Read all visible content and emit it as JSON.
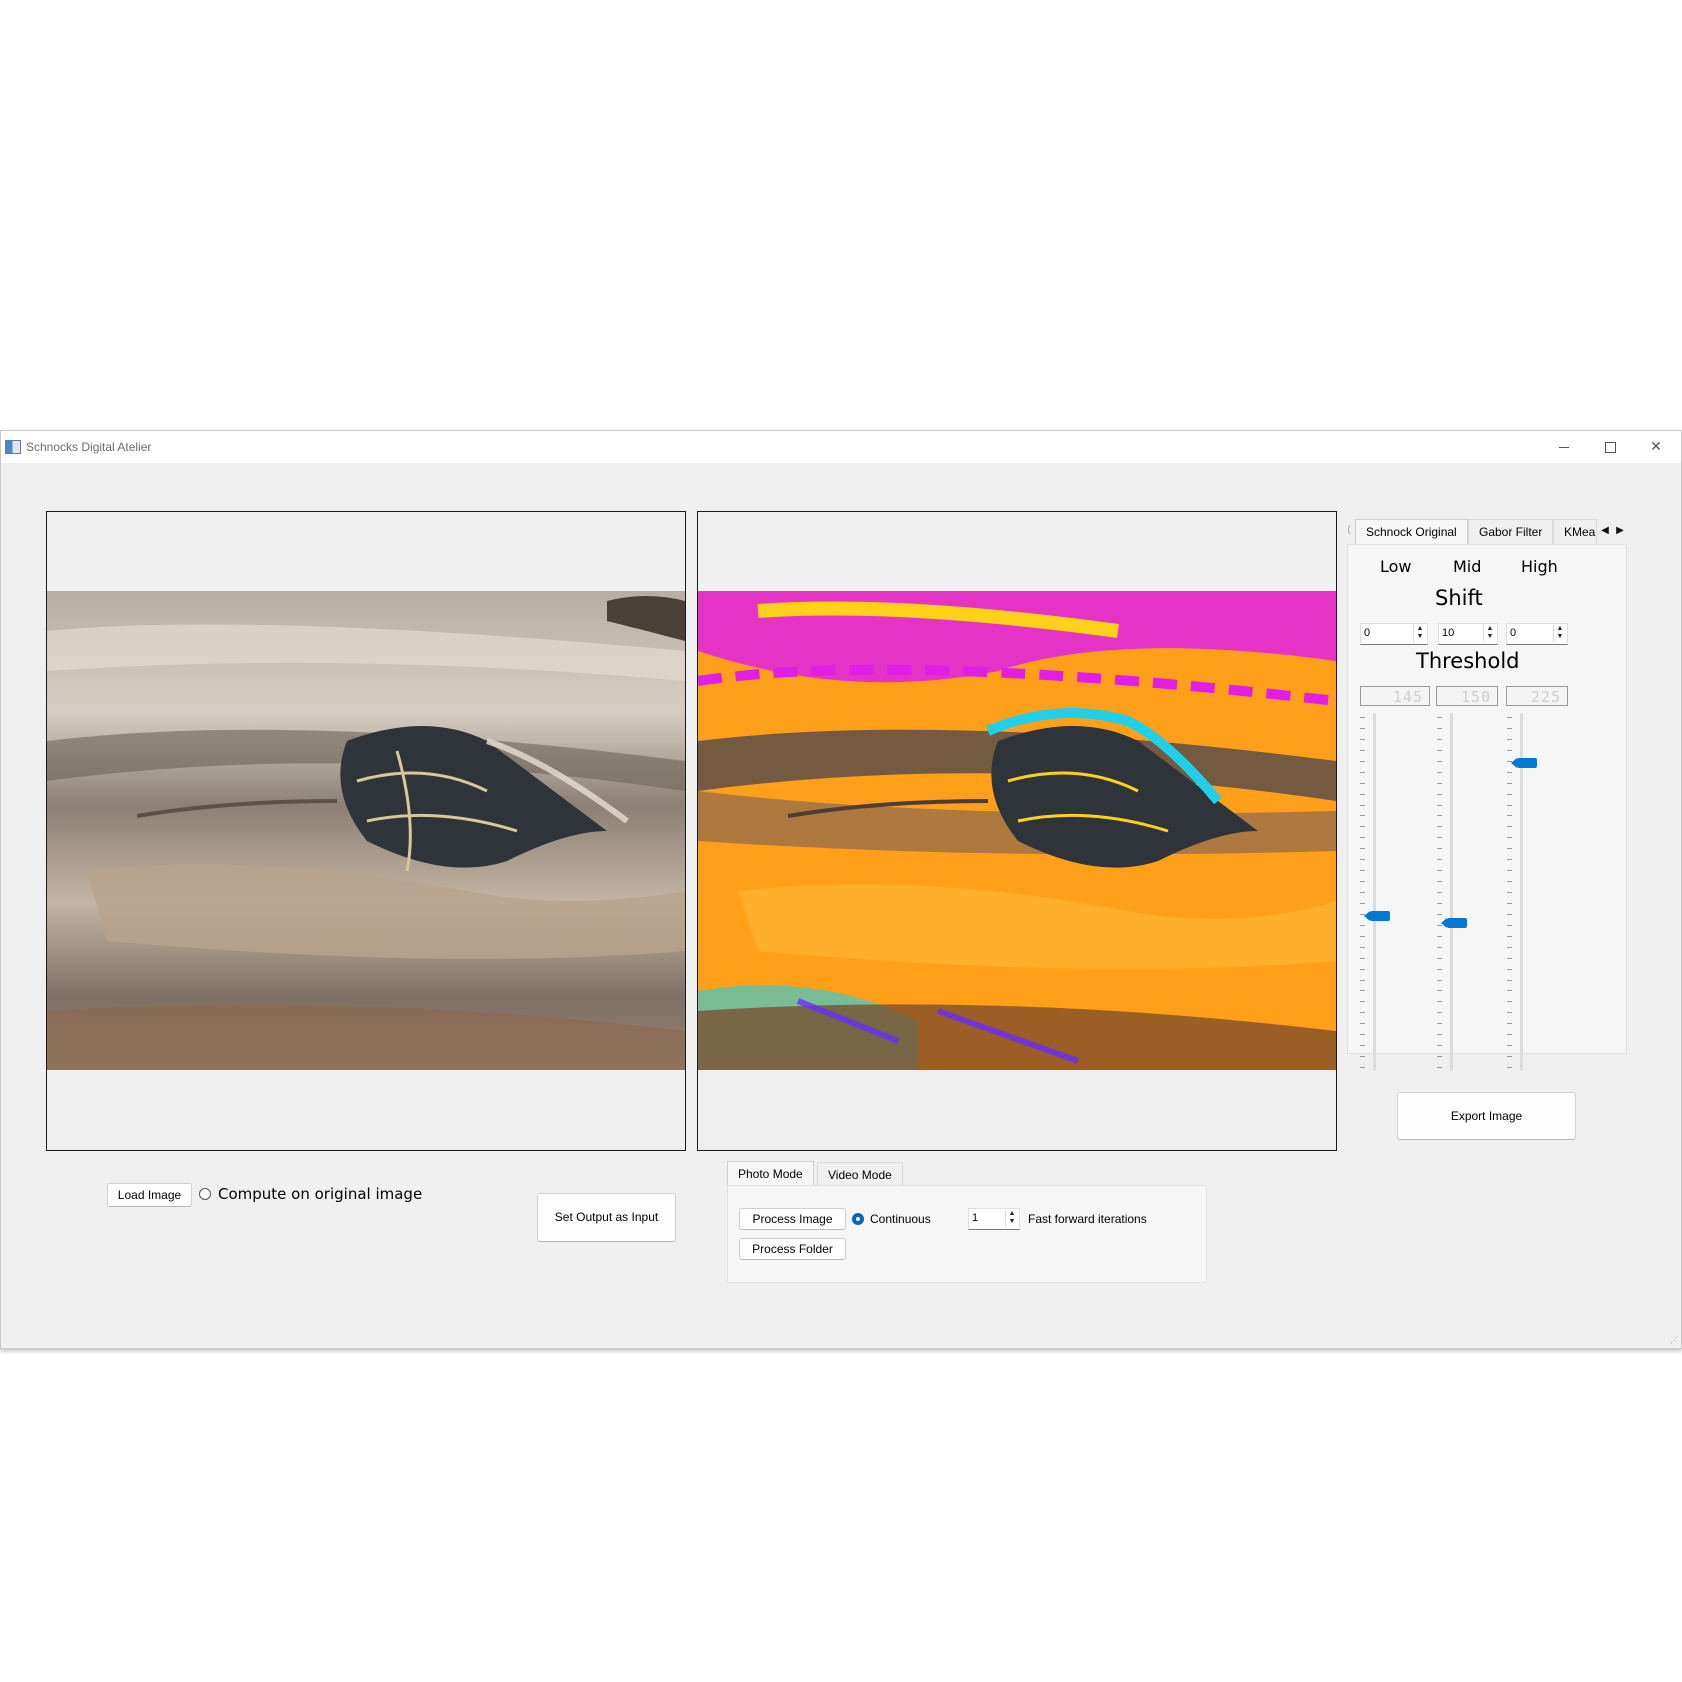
{
  "window": {
    "title": "Schnocks Digital Atelier"
  },
  "side_tabs": [
    "Schnock Original",
    "Gabor Filter",
    "KMea"
  ],
  "columns": {
    "low": "Low",
    "mid": "Mid",
    "high": "High"
  },
  "shift": {
    "label": "Shift",
    "low": "0",
    "mid": "10",
    "high": "0"
  },
  "threshold": {
    "label": "Threshold",
    "low_display": "145",
    "mid_display": "150",
    "high_display": "225",
    "slider_fraction": {
      "low": 0.43,
      "mid": 0.41,
      "high": 0.87
    }
  },
  "export_button": "Export Image",
  "load_image_button": "Load Image",
  "compute_original_label": "Compute on original image",
  "set_output_button": "Set Output as Input",
  "mode_tabs": [
    "Photo Mode",
    "Video Mode"
  ],
  "process_image_button": "Process Image",
  "process_folder_button": "Process Folder",
  "continuous_label": "Continuous",
  "fast_forward": {
    "value": "1",
    "label": "Fast forward iterations"
  },
  "colors": {
    "accent": "#0078d4",
    "psychedelic": [
      "#ff9f1a",
      "#e01ee6",
      "#1fd0e8",
      "#6a2cff",
      "#ffd21a"
    ]
  }
}
